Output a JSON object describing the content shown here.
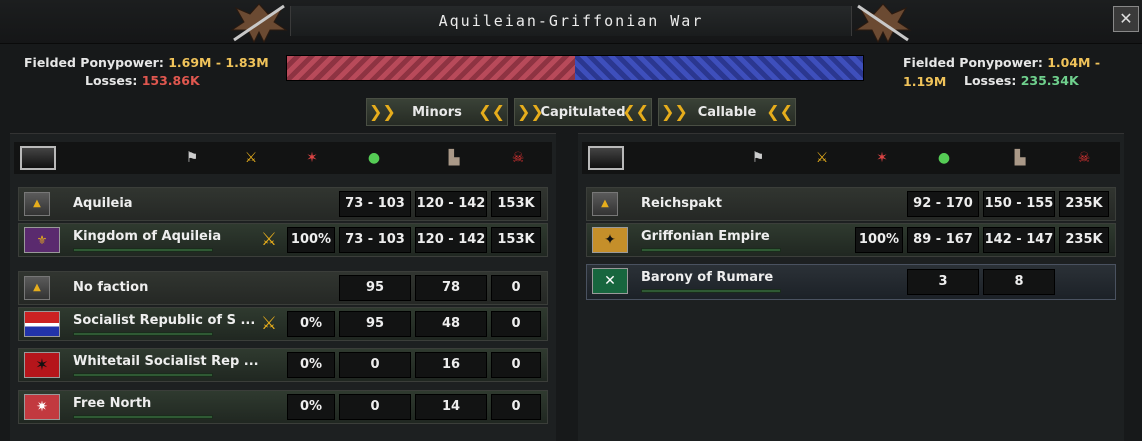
{
  "window": {
    "title": "Aquileian-Griffonian War",
    "close_icon": "close-icon"
  },
  "attacker": {
    "ponypower_label": "Fielded Ponypower:",
    "ponypower": "1.69M - 1.83M",
    "losses_label": "Losses:",
    "losses": "153.86K"
  },
  "defender": {
    "ponypower_label": "Fielded Ponypower:",
    "ponypower": "1.04M - 1.19M",
    "losses_label": "Losses:",
    "losses": "235.34K"
  },
  "war_balance": {
    "attacker_share": 0.5,
    "attacker_color": "#b84a5a",
    "defender_color": "#3e4fbc"
  },
  "filters": [
    {
      "label": "Minors"
    },
    {
      "label": "Capitulated"
    },
    {
      "label": "Callable"
    }
  ],
  "header_icons": [
    "white-flag-icon",
    "crossed-swords-icon",
    "casualties-icon",
    "manpower-icon",
    "factory-icon",
    "skull-icon"
  ],
  "left": {
    "groups": [
      {
        "name": "Aquileia",
        "v1": "73 - 103",
        "v2": "120 - 142",
        "v3": "153K"
      },
      {
        "name": "No faction",
        "v1": "95",
        "v2": "78",
        "v3": "0"
      }
    ],
    "countries": [
      {
        "name": "Kingdom of Aquileia",
        "pct": "100%",
        "v1": "73 - 103",
        "v2": "120 - 142",
        "v3": "153K"
      },
      {
        "name": "Socialist Republic of S ...",
        "pct": "0%",
        "v1": "95",
        "v2": "48",
        "v3": "0"
      },
      {
        "name": "Whitetail Socialist Rep ...",
        "pct": "0%",
        "v1": "0",
        "v2": "16",
        "v3": "0"
      },
      {
        "name": "Free North",
        "pct": "0%",
        "v1": "0",
        "v2": "14",
        "v3": "0"
      }
    ]
  },
  "right": {
    "groups": [
      {
        "name": "Reichspakt",
        "v1": "92 - 170",
        "v2": "150 - 155",
        "v3": "235K"
      }
    ],
    "countries": [
      {
        "name": "Griffonian Empire",
        "pct": "100%",
        "v1": "89 - 167",
        "v2": "142 - 147",
        "v3": "235K"
      },
      {
        "name": "Barony of Rumare",
        "v1": "3",
        "v2": "8"
      }
    ]
  },
  "chevron_left": "❯❯",
  "chevron_right": "❮❮",
  "arrow_up": "▲",
  "colors": {
    "gold": "#f0c35a",
    "red_loss": "#e0574f",
    "green_loss": "#6fd08d"
  }
}
